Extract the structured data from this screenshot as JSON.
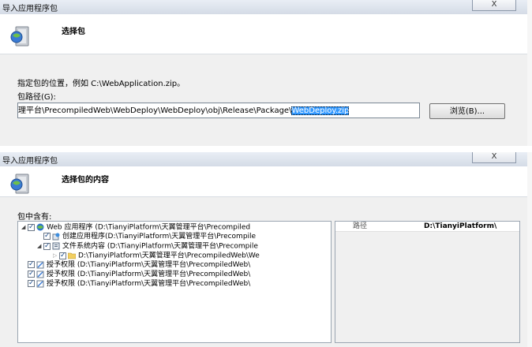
{
  "dialog1": {
    "title": "导入应用程序包",
    "close_label": "X",
    "header_title": "选择包",
    "instruction": "指定包的位置，例如 C:\\WebApplication.zip。",
    "path_label": "包路径(G):",
    "path_value_plain": "理平台\\PrecompiledWeb\\WebDeploy\\WebDeploy\\obj\\Release\\Package\\",
    "path_value_selected": "WebDeploy.zip",
    "browse_label": "浏览(B)..."
  },
  "dialog2": {
    "title": "导入应用程序包",
    "close_label": "X",
    "header_title": "选择包的内容",
    "contents_label": "包中含有:",
    "tree": [
      {
        "text": "Web 应用程序 (D:\\TianyiPlatform\\天翼管理平台\\Precompiled",
        "icon": "globe-icon"
      },
      {
        "text": "创建应用程序(D:\\TianyiPlatform\\天翼管理平台\\Precompile",
        "icon": "app-icon"
      },
      {
        "text": "文件系统内容 (D:\\TianyiPlatform\\天翼管理平台\\Precompile",
        "icon": "filesystem-icon"
      },
      {
        "text": "D:\\TianyiPlatform\\天翼管理平台\\PrecompiledWeb\\We",
        "icon": "folder-icon"
      },
      {
        "text": "授予权限 (D:\\TianyiPlatform\\天翼管理平台\\PrecompiledWeb\\",
        "icon": "permission-icon"
      },
      {
        "text": "授予权限 (D:\\TianyiPlatform\\天翼管理平台\\PrecompiledWeb\\",
        "icon": "permission-icon"
      },
      {
        "text": "授予权限 (D:\\TianyiPlatform\\天翼管理平台\\PrecompiledWeb\\",
        "icon": "permission-icon"
      }
    ],
    "props_key": "路径",
    "props_value": "D:\\TianyiPlatform\\"
  }
}
